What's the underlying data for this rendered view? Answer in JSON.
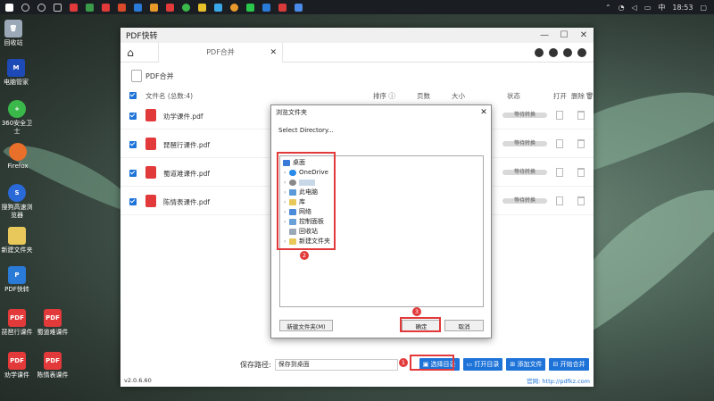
{
  "taskbar": {
    "time": "18:53",
    "lang": "中"
  },
  "desktop_icons": [
    {
      "label": "回收站"
    },
    {
      "label": "电脑管家"
    },
    {
      "label": "360安全卫士"
    },
    {
      "label": "Firefox"
    },
    {
      "label": "搜狗高速浏览器"
    },
    {
      "label": "新建文件夹"
    },
    {
      "label": "PDF快转"
    },
    {
      "label": "琵琶行课件"
    },
    {
      "label": "蜀道难课件"
    },
    {
      "label": "劝学课件"
    },
    {
      "label": "陈情表课件"
    }
  ],
  "window": {
    "title": "PDF快转",
    "tab_label": "PDF合并",
    "section_title": "PDF合并",
    "columns": {
      "filename": "文件名 (总数:4)",
      "order": "排序",
      "pages": "页数",
      "size": "大小",
      "status": "状态",
      "open": "打开",
      "delete": "删除"
    },
    "files": [
      {
        "name": "劝学课件.pdf",
        "status": "等待转换"
      },
      {
        "name": "琵琶行课件.pdf",
        "status": "等待转换"
      },
      {
        "name": "蜀道难课件.pdf",
        "status": "等待转换"
      },
      {
        "name": "陈情表课件.pdf",
        "status": "等待转换"
      }
    ],
    "save_path_label": "保存路径:",
    "save_path_value": "保存到桌面",
    "buttons": {
      "choose_dir": "选择目录",
      "open_dir": "打开目录",
      "add_file": "添加文件",
      "start_merge": "开始合并"
    },
    "version": "v2.0.6.60",
    "website": "官网: http://pdfkz.com"
  },
  "dialog": {
    "title": "浏览文件夹",
    "prompt": "Select Directory...",
    "tree": [
      {
        "label": "桌面"
      },
      {
        "label": "OneDrive"
      },
      {
        "label": ""
      },
      {
        "label": "此电脑"
      },
      {
        "label": "库"
      },
      {
        "label": "网络"
      },
      {
        "label": "控制面板"
      },
      {
        "label": "回收站"
      },
      {
        "label": "新建文件夹"
      }
    ],
    "new_folder": "新建文件夹(M)",
    "ok": "确定",
    "cancel": "取消"
  },
  "badges": [
    "1",
    "2",
    "3"
  ],
  "colors": {
    "accent": "#1e73d8",
    "highlight": "#e23a3a"
  }
}
